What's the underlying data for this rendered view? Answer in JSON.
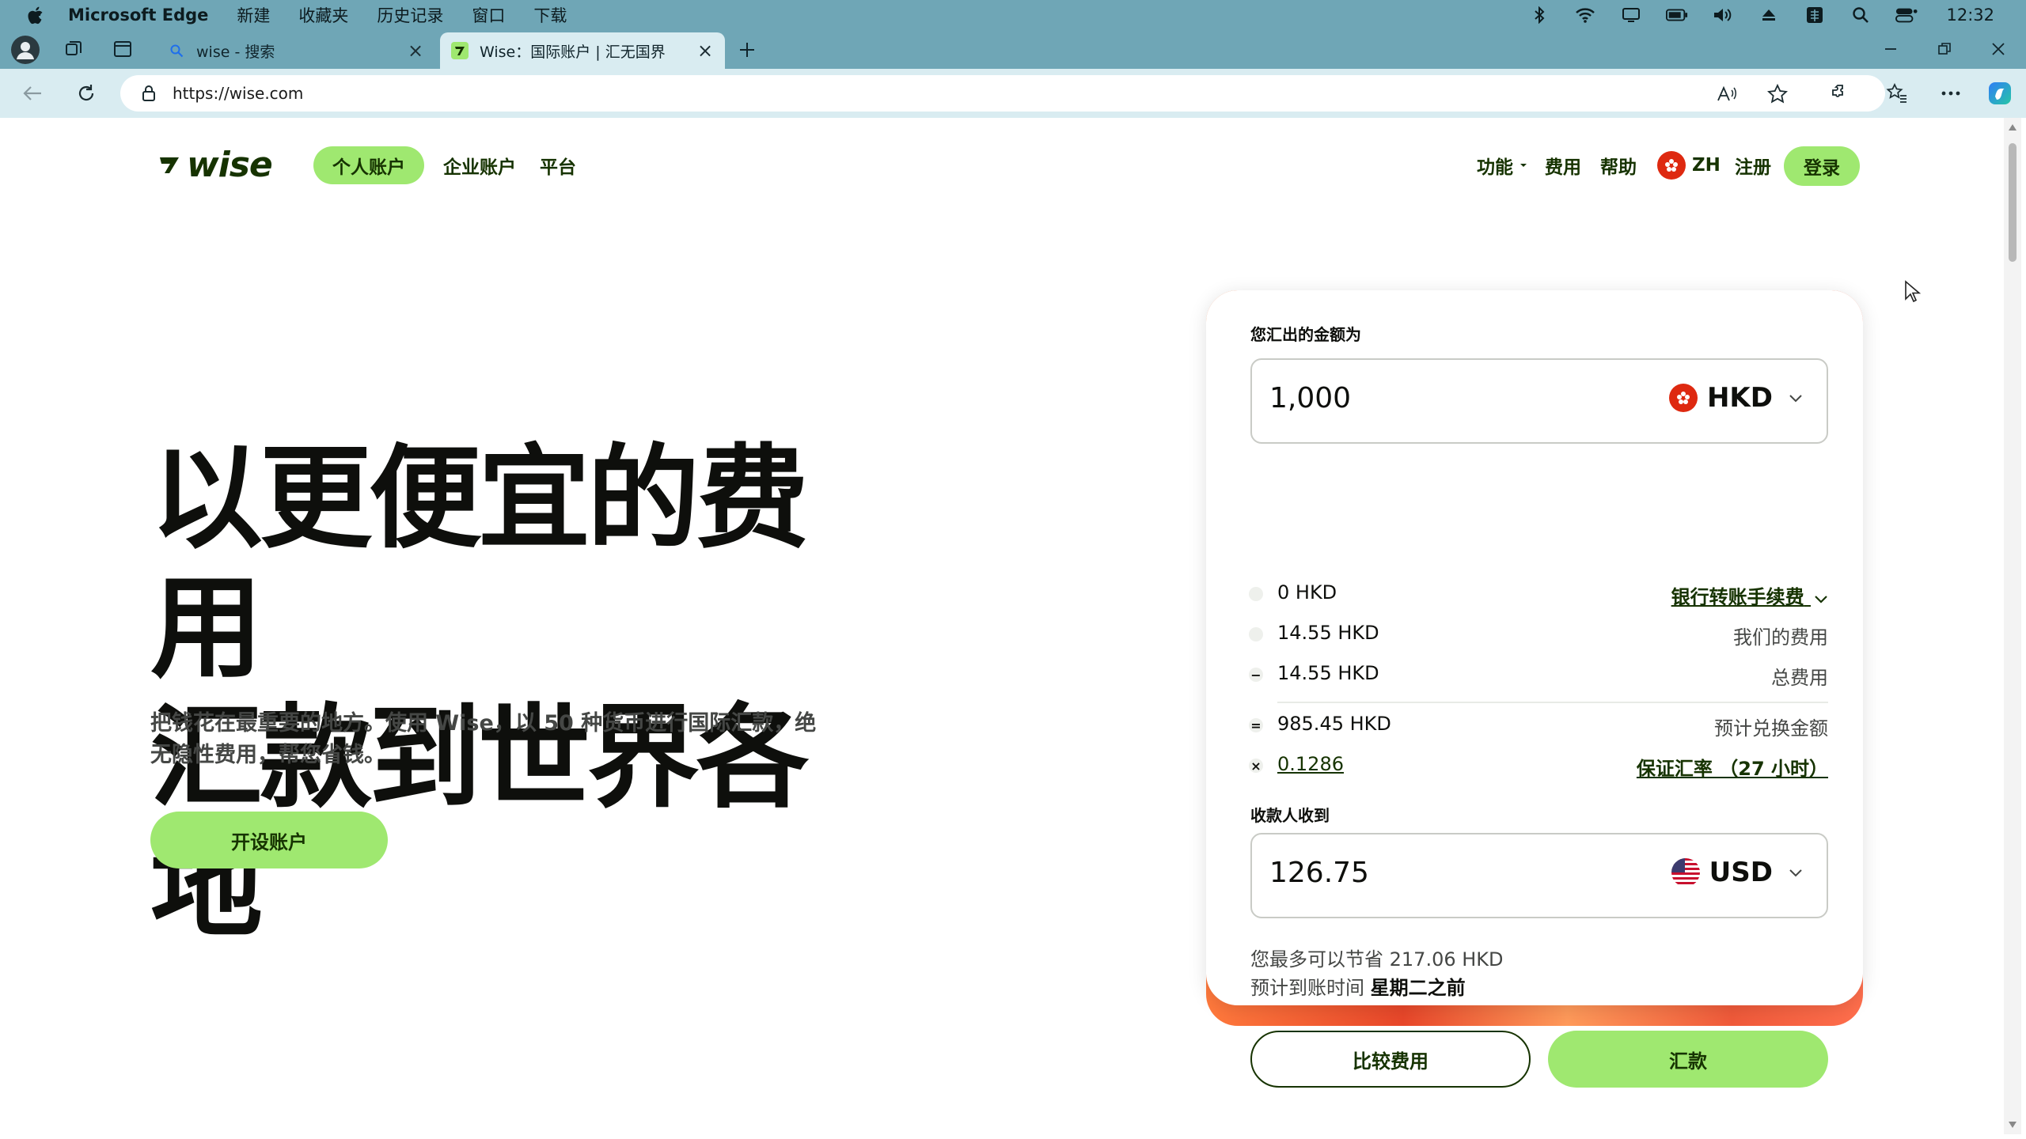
{
  "menubar": {
    "app_name": "Microsoft Edge",
    "items": [
      "新建",
      "收藏夹",
      "历史记录",
      "窗口",
      "下载"
    ],
    "clock": "12:32"
  },
  "tabs": [
    {
      "title": "wise - 搜索",
      "icon": "search-icon"
    },
    {
      "title": "Wise：国际账户 | 汇无国界",
      "icon": "wise-favicon"
    }
  ],
  "address": {
    "url": "https://wise.com"
  },
  "site": {
    "logo": "wise",
    "nav_left": [
      "个人账户",
      "企业账户",
      "平台"
    ],
    "nav_right": {
      "features": "功能",
      "pricing": "费用",
      "help": "帮助",
      "lang": "ZH",
      "register": "注册",
      "login": "登录"
    }
  },
  "hero": {
    "title_line1": "以更便宜的费用",
    "title_line2": "汇款到世界各地",
    "subtitle_line1": "把钱花在最重要的地方。使用 Wise，以 50 种货币进行国际汇款，绝",
    "subtitle_line2": "无隐性费用，帮您省钱。",
    "cta": "开设账户"
  },
  "calculator": {
    "send_label": "您汇出的金额为",
    "send_amount": "1,000",
    "send_currency": "HKD",
    "fees": [
      {
        "symbol": "",
        "value": "0 HKD",
        "desc": "银行转账手续费",
        "desc_link": true
      },
      {
        "symbol": "",
        "value": "14.55 HKD",
        "desc": "我们的费用",
        "desc_link": false
      },
      {
        "symbol": "−",
        "value": "14.55 HKD",
        "desc": "总费用",
        "desc_link": false
      }
    ],
    "converted": {
      "symbol": "=",
      "value": "985.45 HKD",
      "desc": "预计兑换金额"
    },
    "rate": {
      "symbol": "×",
      "value": "0.1286",
      "desc": "保证汇率 （27 小时）"
    },
    "receive_label": "收款人收到",
    "receive_amount": "126.75",
    "receive_currency": "USD",
    "saving_prefix": "您最多可以节省 ",
    "saving_amount": "217.06 HKD",
    "eta_prefix": "预计到账时间 ",
    "eta_value": "星期二之前",
    "compare_btn": "比较费用",
    "send_btn": "汇款"
  },
  "colors": {
    "brand_green": "#9fe870",
    "brand_dark": "#163300",
    "chrome_blue": "#6fa6b6"
  }
}
